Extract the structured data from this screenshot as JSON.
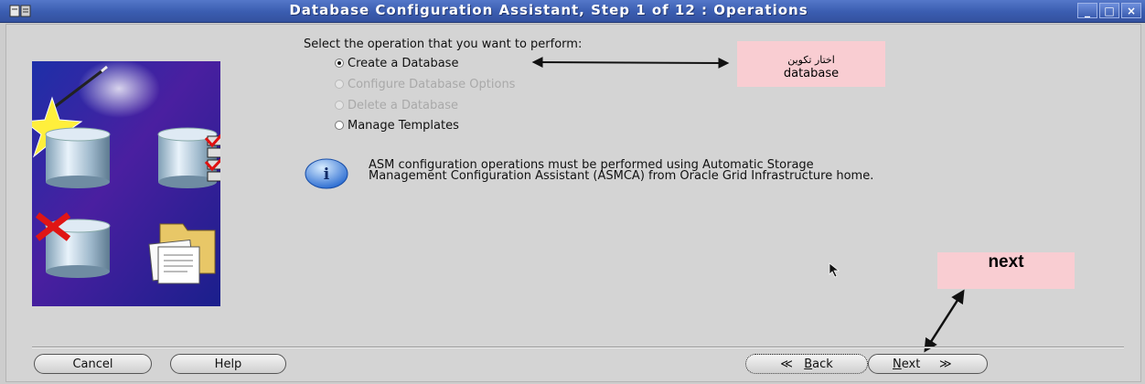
{
  "window": {
    "title": "Database Configuration Assistant, Step 1 of 12 : Operations",
    "minimize_glyph": "_",
    "maximize_glyph": "□",
    "close_glyph": "×"
  },
  "main": {
    "prompt": "Select the operation that you want to perform:",
    "options": [
      {
        "label": "Create a Database",
        "selected": true,
        "enabled": true
      },
      {
        "label": "Configure Database Options",
        "selected": false,
        "enabled": false
      },
      {
        "label": "Delete a Database",
        "selected": false,
        "enabled": false
      },
      {
        "label": "Manage Templates",
        "selected": false,
        "enabled": true
      }
    ],
    "info_line1": "ASM configuration operations must be performed using Automatic Storage",
    "info_line2": "Management Configuration Assistant (ASMCA) from Oracle Grid Infrastructure home."
  },
  "annotations": {
    "create_note_line1": "اختار تكوين",
    "create_note_line2": "database",
    "next_callout": "next"
  },
  "footer": {
    "cancel": "Cancel",
    "help": "Help",
    "back_glyph": "≪",
    "back_mnemonic": "B",
    "back_rest": "ack",
    "next_mnemonic": "N",
    "next_rest": "ext",
    "next_glyph": "≫"
  },
  "colors": {
    "title_bar": "#3a5cb0",
    "annotation_bg": "#f9cdd2",
    "panel_bg": "#d4d4d4"
  }
}
